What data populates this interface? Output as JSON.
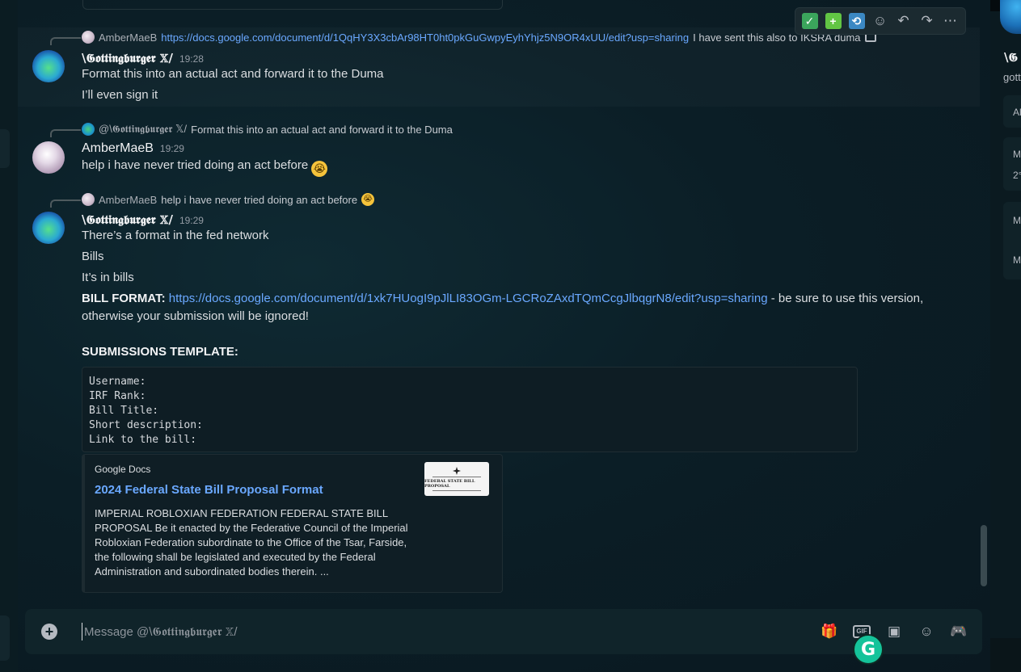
{
  "messages": [
    {
      "reply": {
        "name": "AmberMaeB",
        "link": "https://docs.google.com/document/d/1QqHY3X3cbAr98HT0ht0pkGuGwpyEyhYhjz5N9OR4xUU/edit?usp=sharing",
        "text": "I have sent this also to IKSRA duma"
      },
      "author": "\\𝕲𝖔𝖙𝖙𝖎𝖓𝖌𝖇𝖚𝖗𝖌𝖊𝖗 𝕏/",
      "time": "19:28",
      "lines": [
        "Format this into an actual act and forward it to the Duma",
        "I’ll even sign it"
      ]
    },
    {
      "reply": {
        "name": "@\\𝕲𝖔𝖙𝖙𝖎𝖓𝖌𝖇𝖚𝖗𝖌𝖊𝖗 𝕏/",
        "text": "Format this into an actual act and forward it to the Duma"
      },
      "author": "AmberMaeB",
      "time": "19:29",
      "lines": [
        "help i have never tried doing an act before"
      ]
    },
    {
      "reply": {
        "name": "AmberMaeB",
        "text": "help i have never tried doing an act before"
      },
      "author": "\\𝕲𝖔𝖙𝖙𝖎𝖓𝖌𝖇𝖚𝖗𝖌𝖊𝖗 𝕏/",
      "time": "19:29",
      "lines": [
        "There’s a format in the fed network",
        "Bills",
        "It’s in bills"
      ],
      "bill_format_label": "BILL FORMAT:",
      "bill_format_link": "https://docs.google.com/document/d/1xk7HUogI9pJlLI83OGm-LGCRoZAxdTQmCcgJlbqgrN8/edit?usp=sharing",
      "bill_format_suffix": "- be sure to use this version,",
      "bill_format_line2": "otherwise your submission will be ignored!",
      "submissions_label": "SUBMISSIONS TEMPLATE:",
      "code_lines": [
        "Username:",
        "IRF Rank:",
        "Bill Title:",
        "Short description:",
        "Link to the bill:"
      ],
      "embed": {
        "provider": "Google Docs",
        "title": "2024 Federal State Bill Proposal Format",
        "description": "IMPERIAL ROBLOXIAN FEDERATION FEDERAL STATE BILL PROPOSAL Be it enacted by the Federative Council of the Imperial Robloxian Federation subordinate to the Office of the Tsar, Farside, the following shall be legislated and executed by the Federal Administration and subordinated bodies therein. ...",
        "thumb_text": "FEDERAL STATE BILL PROPOSAL"
      }
    }
  ],
  "toolbar_icons": [
    "check-reaction-icon",
    "plus-reaction-icon",
    "repeat-reaction-icon",
    "add-reaction-icon",
    "reply-icon",
    "forward-icon",
    "more-icon"
  ],
  "input": {
    "placeholder": "Message @\\𝕲𝖔𝖙𝖙𝖎𝖓𝖌𝖇𝖚𝖗𝖌𝖊𝖗 𝕏/",
    "gif_label": "GIF"
  },
  "right_panel": {
    "name": "\\𝕲",
    "sub": "gott",
    "items": [
      "Al",
      "M",
      "2°",
      "M",
      "M"
    ]
  },
  "grammarly_label": "G",
  "colors": {
    "link": "#6aa8ff",
    "background": "#0b1e26",
    "check": "#3ba55c",
    "plus": "#62c544",
    "repeat": "#3b88c3"
  }
}
